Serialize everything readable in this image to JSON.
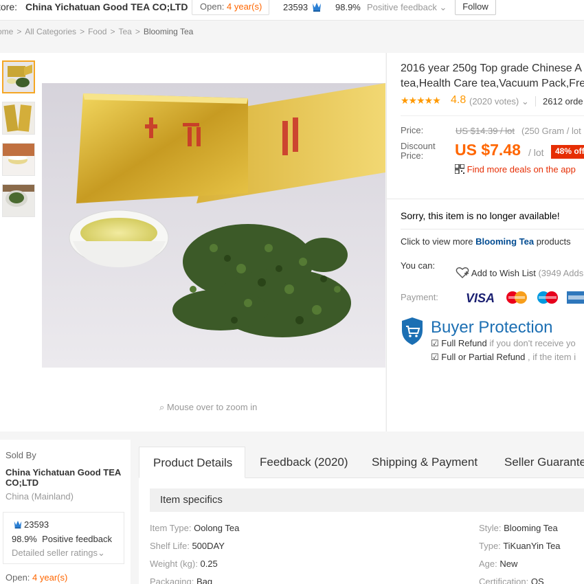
{
  "store_bar": {
    "label": "tore:",
    "store_name": "China Yichatuan Good TEA CO;LTD",
    "open_prefix": "Open:",
    "open_years": "4 year(s)",
    "score": "23593",
    "positive_pct": "98.9%",
    "positive_label": "Positive feedback",
    "follow": "Follow"
  },
  "breadcrumb": [
    "ome",
    "All Categories",
    "Food",
    "Tea",
    "Blooming Tea"
  ],
  "gallery": {
    "zoom_hint": "Mouse over to zoom in"
  },
  "product": {
    "title_line1": "2016 year 250g Top grade Chinese A",
    "title_line2": "tea,Health Care tea,Vacuum Pack,Fre",
    "rating": "4.8",
    "votes": "(2020 votes)",
    "orders": "2612 orde",
    "price_label": "Price:",
    "old_price": "US $14.39 / lot",
    "unit_info": "(250 Gram / lot",
    "discount_label": "Discount Price:",
    "new_price": "US $7.48",
    "per_lot": "/ lot",
    "off_badge": "48% off",
    "app_deal": "Find more deals on the app",
    "unavailable": "Sorry, this item is no longer available!",
    "click_view_prefix": "Click to view more",
    "click_view_link": "Blooming Tea",
    "click_view_suffix": "products",
    "you_can": "You can:",
    "wish_label": "Add to Wish List",
    "wish_count": "(3949 Adds",
    "payment_label": "Payment:",
    "buyer_protection": "Buyer Protection",
    "bp_full_refund": "Full Refund",
    "bp_full_refund_note": "if you don't receive yo",
    "bp_partial_refund": "Full or Partial Refund",
    "bp_partial_note": ", if the item i"
  },
  "seller": {
    "sold_by": "Sold By",
    "name": "China Yichatuan Good TEA CO;LTD",
    "region": "China (Mainland)",
    "score": "23593",
    "positive_pct": "98.9%",
    "positive_label": "Positive feedback",
    "detailed": "Detailed seller ratings",
    "open_prefix": "Open:",
    "open_years": "4 year(s)"
  },
  "tabs": [
    "Product Details",
    "Feedback (2020)",
    "Shipping & Payment",
    "Seller Guarante"
  ],
  "specs": {
    "header": "Item specifics",
    "left": [
      {
        "k": "Item Type:",
        "v": "Oolong Tea"
      },
      {
        "k": "Shelf Life:",
        "v": "500DAY"
      },
      {
        "k": "Weight (kg):",
        "v": "0.25"
      },
      {
        "k": "Packaging:",
        "v": "Bag"
      }
    ],
    "right": [
      {
        "k": "Style:",
        "v": "Blooming Tea"
      },
      {
        "k": "Type:",
        "v": "TiKuanYin Tea"
      },
      {
        "k": "Age:",
        "v": "New"
      },
      {
        "k": "Certification:",
        "v": "QS"
      }
    ]
  },
  "colors": {
    "accent_orange": "#ff6600",
    "badge_red": "#e62e04",
    "link_blue": "#004b91",
    "protection_blue": "#1c6fb3"
  }
}
